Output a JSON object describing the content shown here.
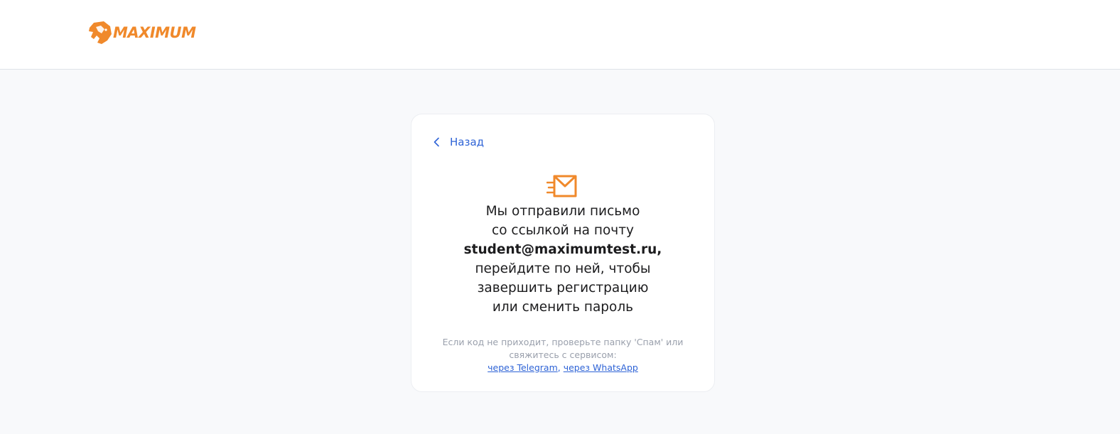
{
  "header": {
    "logo_text": "MAXIMUM"
  },
  "card": {
    "back_label": "Назад",
    "message": {
      "line1": "Мы отправили письмо",
      "line2": "со ссылкой на почту",
      "email": "student@maximumtest.ru,",
      "line3": "перейдите по ней, чтобы",
      "line4": "завершить регистрацию",
      "line5": "или сменить пароль"
    },
    "hint": {
      "line1": "Если код не приходит, проверьте папку 'Спам' или",
      "line2": "свяжитесь с сервисом:",
      "separator": ",",
      "telegram_link": "через Telegram",
      "whatsapp_link": "через WhatsApp"
    }
  },
  "colors": {
    "brand_orange": "#f0892b",
    "link_blue": "#2e63d6",
    "page_background": "#f8f9fb"
  },
  "icons": {
    "logo_mark": "elephant-head-icon",
    "back": "chevron-left-icon",
    "mail": "envelope-sent-icon"
  }
}
